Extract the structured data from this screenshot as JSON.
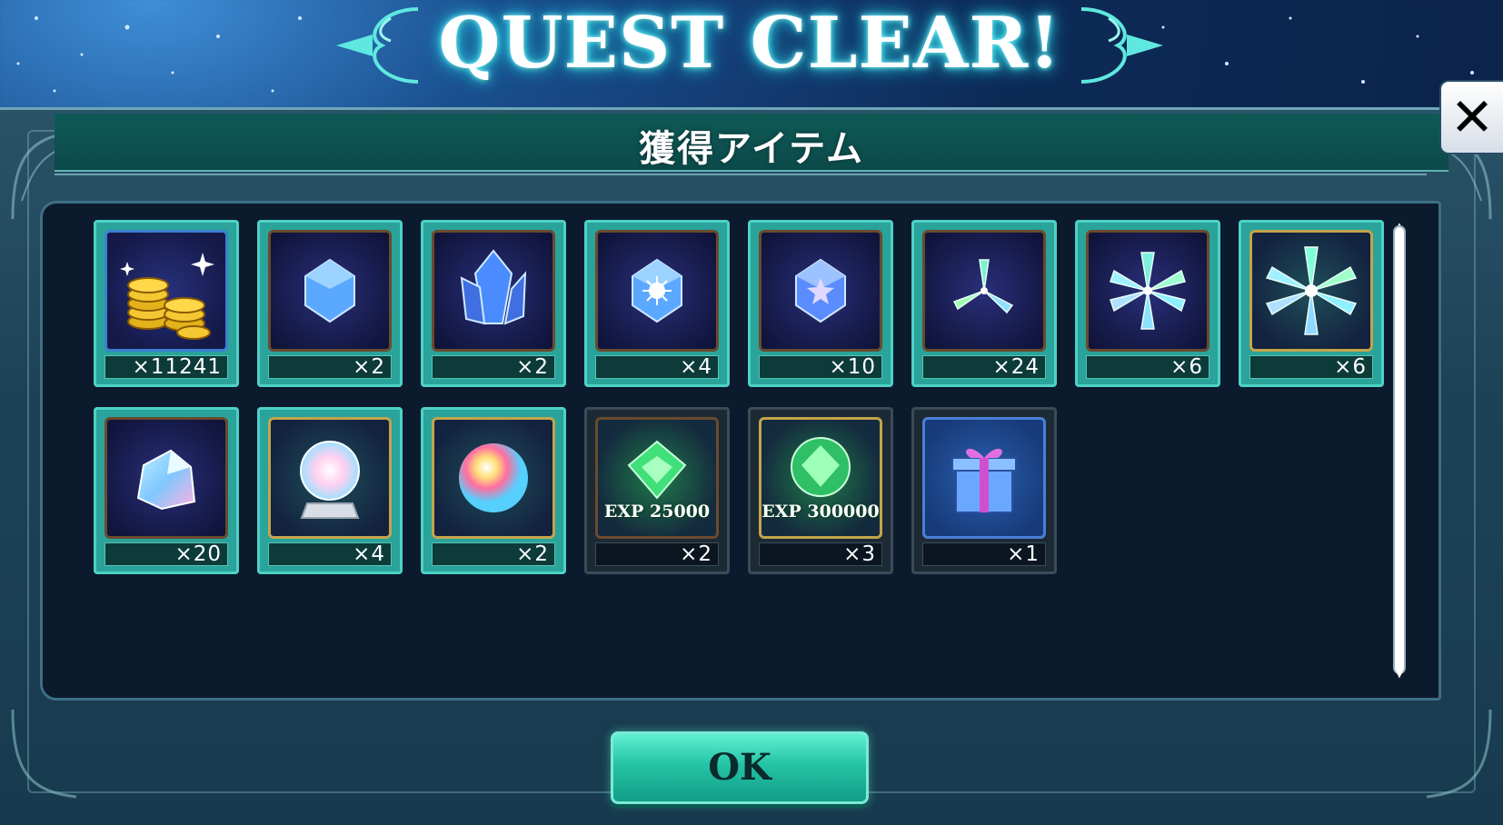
{
  "title": "QUEST CLEAR!",
  "dialog": {
    "header_title": "獲得アイテム",
    "close_glyph": "✕",
    "ok_label": "OK"
  },
  "items": [
    {
      "icon": "gold-coins-icon",
      "count": "×11241",
      "frame": "blue"
    },
    {
      "icon": "blue-moon-gem-icon",
      "count": "×2",
      "frame": "brown"
    },
    {
      "icon": "moon-crystal-cluster-icon",
      "count": "×2",
      "frame": "brown"
    },
    {
      "icon": "sun-gem-icon",
      "count": "×4",
      "frame": "brown"
    },
    {
      "icon": "star-gem-icon",
      "count": "×10",
      "frame": "brown"
    },
    {
      "icon": "crystal-shard-three-icon",
      "count": "×24",
      "frame": "brown"
    },
    {
      "icon": "crystal-shard-star-icon",
      "count": "×6",
      "frame": "brown"
    },
    {
      "icon": "crystal-snowflake-icon",
      "count": "×6",
      "frame": "gold"
    },
    {
      "icon": "rainbow-ore-icon",
      "count": "×20",
      "frame": "brown"
    },
    {
      "icon": "crystal-ball-icon",
      "count": "×4",
      "frame": "gold"
    },
    {
      "icon": "rainbow-orb-icon",
      "count": "×2",
      "frame": "gold"
    },
    {
      "icon": "exp-crystal-icon",
      "count": "×2",
      "frame": "brown",
      "label": "EXP 25000",
      "dark": true
    },
    {
      "icon": "exp-crystal-large-icon",
      "count": "×3",
      "frame": "gold",
      "label": "EXP 300000",
      "dark": true
    },
    {
      "icon": "gift-box-icon",
      "count": "×1",
      "frame": "gift",
      "dark": true
    }
  ],
  "colors": {
    "accent_teal": "#2aa39a",
    "ok_button": "#25c3a6",
    "panel_bg": "#0b1a2c"
  }
}
